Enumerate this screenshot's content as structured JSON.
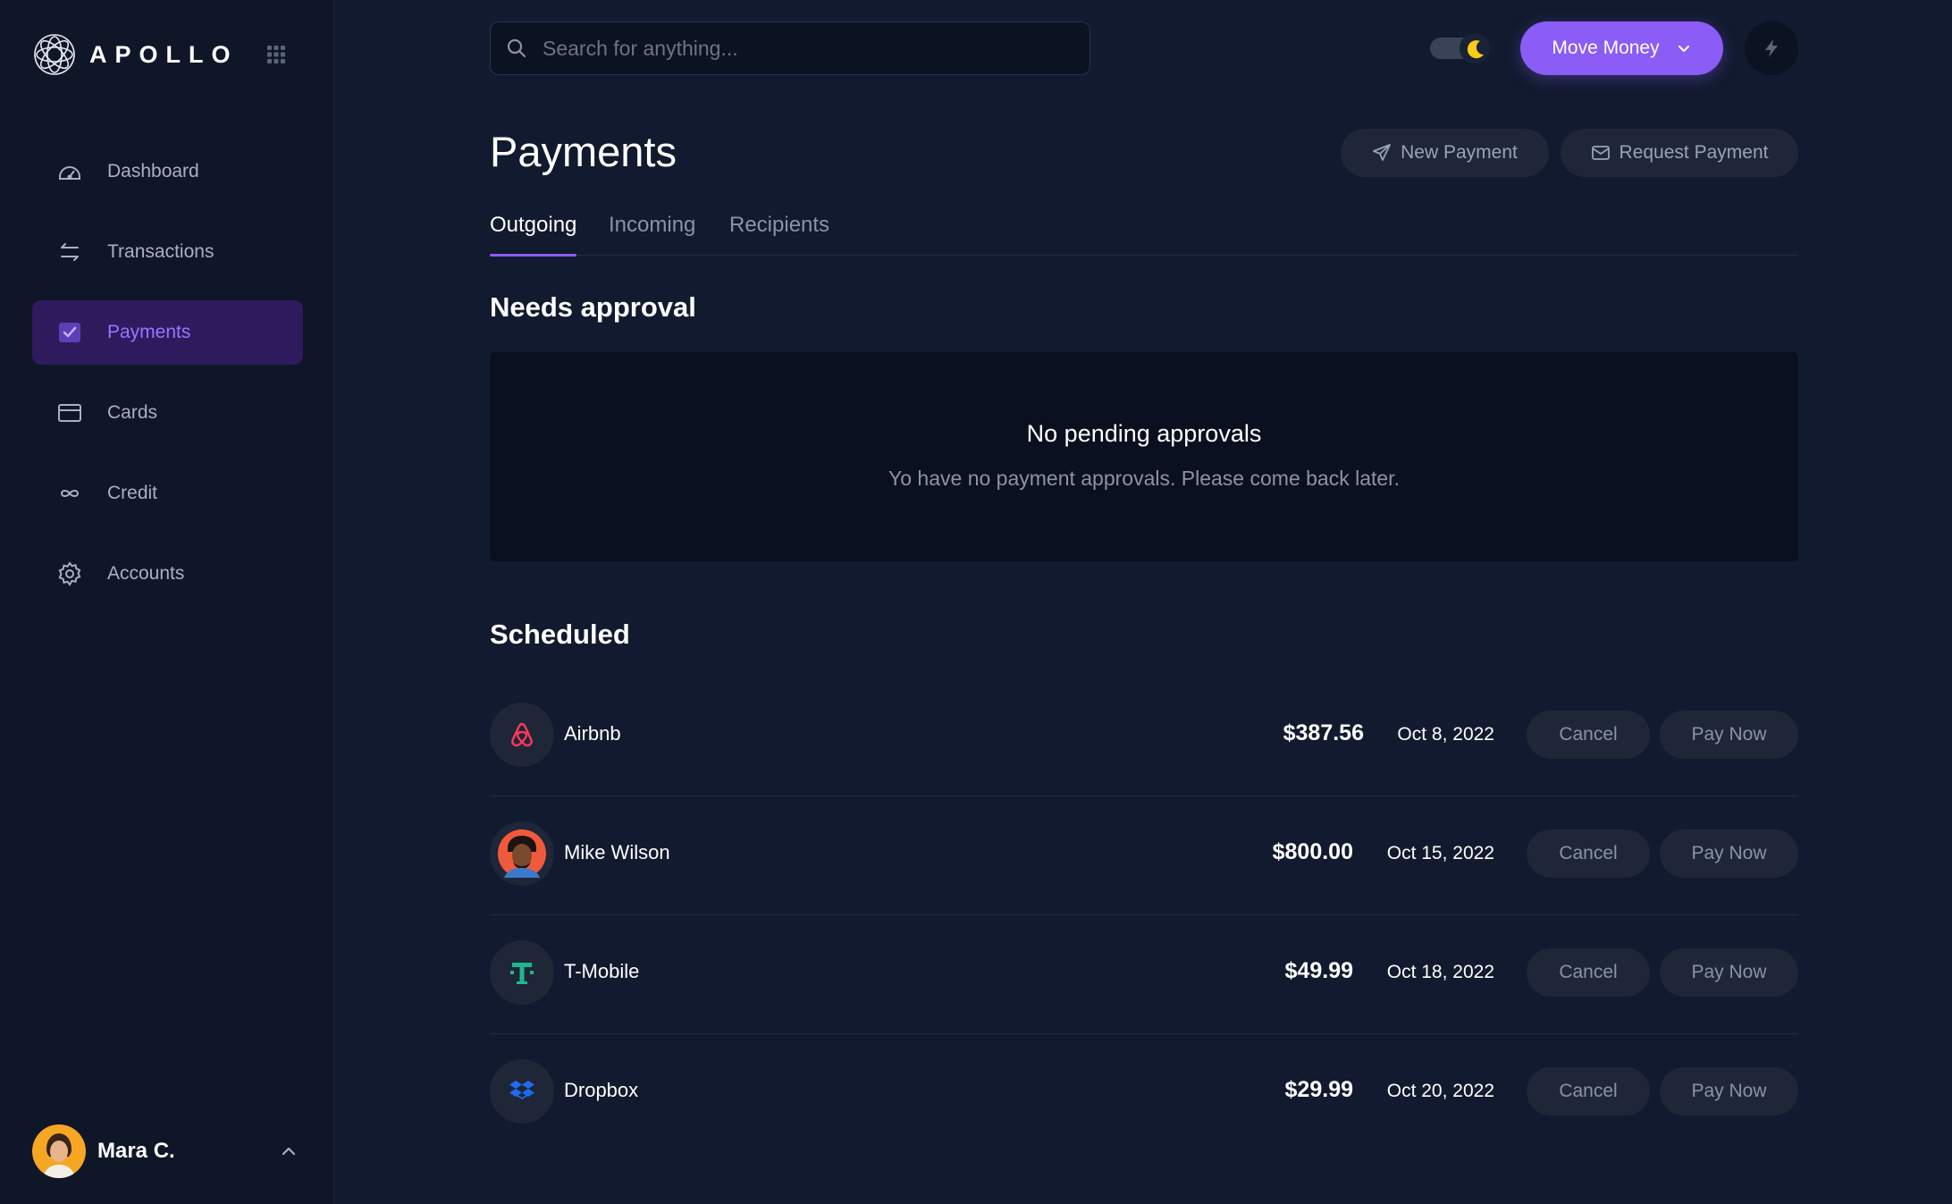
{
  "brand": {
    "name": "APOLLO"
  },
  "sidebar": {
    "items": [
      {
        "label": "Dashboard",
        "icon": "gauge-icon",
        "active": false
      },
      {
        "label": "Transactions",
        "icon": "swap-arrows-icon",
        "active": false
      },
      {
        "label": "Payments",
        "icon": "checkbox-icon",
        "active": true
      },
      {
        "label": "Cards",
        "icon": "card-icon",
        "active": false
      },
      {
        "label": "Credit",
        "icon": "infinity-icon",
        "active": false
      },
      {
        "label": "Accounts",
        "icon": "gear-icon",
        "active": false
      }
    ],
    "user": {
      "name": "Mara C."
    }
  },
  "topbar": {
    "search_placeholder": "Search for anything...",
    "move_money_label": "Move Money"
  },
  "page": {
    "title": "Payments",
    "new_payment_label": "New Payment",
    "request_payment_label": "Request Payment",
    "tabs": [
      {
        "label": "Outgoing",
        "active": true
      },
      {
        "label": "Incoming",
        "active": false
      },
      {
        "label": "Recipients",
        "active": false
      }
    ],
    "needs_approval": {
      "title": "Needs approval",
      "empty_title": "No pending approvals",
      "empty_message": "Yo have no payment approvals. Please come back later."
    },
    "scheduled": {
      "title": "Scheduled",
      "cancel_label": "Cancel",
      "pay_now_label": "Pay Now",
      "rows": [
        {
          "payee": "Airbnb",
          "amount": "$387.56",
          "date": "Oct 8, 2022",
          "icon": "airbnb-icon"
        },
        {
          "payee": "Mike Wilson",
          "amount": "$800.00",
          "date": "Oct 15, 2022",
          "icon": "avatar"
        },
        {
          "payee": "T-Mobile",
          "amount": "$49.99",
          "date": "Oct 18, 2022",
          "icon": "tmobile-icon"
        },
        {
          "payee": "Dropbox",
          "amount": "$29.99",
          "date": "Oct 20, 2022",
          "icon": "dropbox-icon"
        }
      ]
    }
  },
  "colors": {
    "accent": "#8b5cf6",
    "background": "#111a2e",
    "sidebar": "#0f1628",
    "active_nav_bg": "#2d1b5e"
  }
}
